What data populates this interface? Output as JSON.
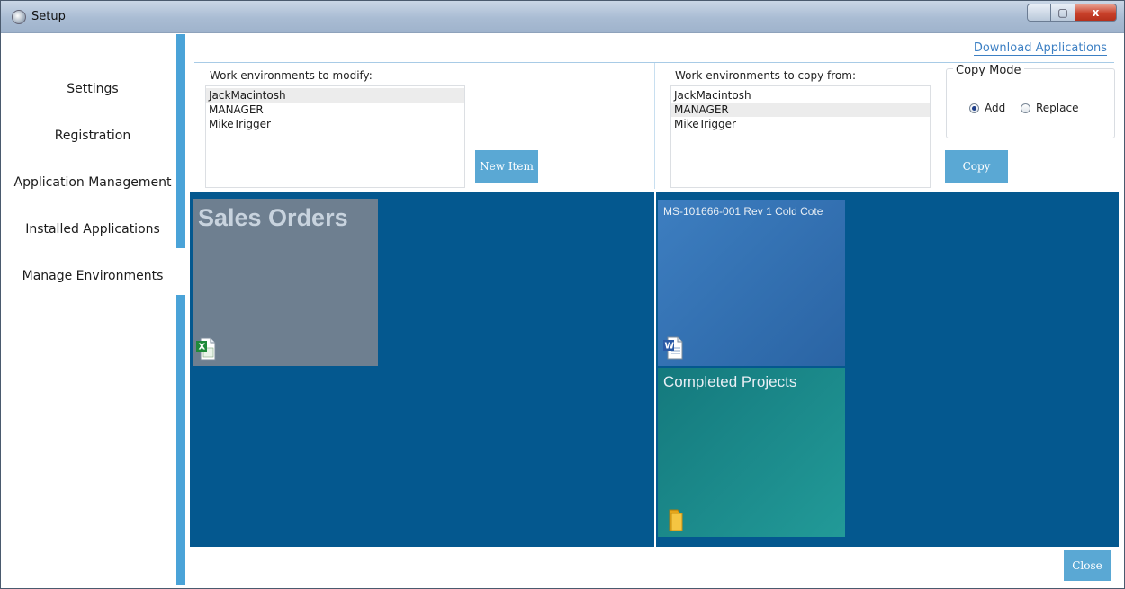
{
  "window": {
    "title": "Setup",
    "min_glyph": "—",
    "max_glyph": "▢",
    "close_glyph": "x"
  },
  "nav": {
    "items": [
      {
        "label": "Settings"
      },
      {
        "label": "Registration"
      },
      {
        "label": "Application Management"
      },
      {
        "label": "Installed Applications"
      },
      {
        "label": "Manage Environments"
      }
    ]
  },
  "header": {
    "download_link": "Download Applications"
  },
  "modify": {
    "label": "Work environments to modify:",
    "items": [
      "JackMacintosh",
      "MANAGER",
      "MikeTrigger"
    ],
    "selected_index": 0,
    "new_item_label": "New Item"
  },
  "copy_from": {
    "label": "Work environments to copy from:",
    "items": [
      "JackMacintosh",
      "MANAGER",
      "MikeTrigger"
    ],
    "selected_index": 1,
    "copy_label": "Copy"
  },
  "copy_mode": {
    "legend": "Copy Mode",
    "options": [
      "Add",
      "Replace"
    ],
    "selected": "Add"
  },
  "left_panel": {
    "tiles": [
      {
        "title": "Sales Orders",
        "icon": "excel-file-icon",
        "color": "#6e7f90"
      }
    ]
  },
  "right_panel": {
    "tiles": [
      {
        "title": "MS-101666-001 Rev 1 Cold Cote",
        "icon": "word-file-icon",
        "color": "#2b6aa8"
      },
      {
        "title": "Completed Projects",
        "icon": "folder-icon",
        "color": "#1a8585"
      }
    ]
  },
  "footer": {
    "close_label": "Close"
  },
  "colors": {
    "accent": "#4aa3d8",
    "panel_bg": "#04588f",
    "button": "#5aa8d4",
    "link": "#3d80c4"
  }
}
